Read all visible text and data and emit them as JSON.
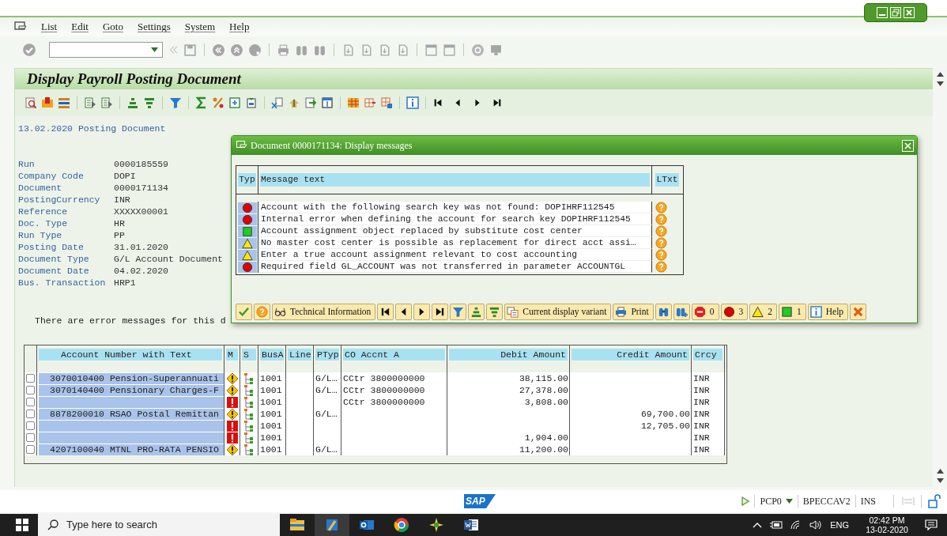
{
  "menu_bar": [
    "List",
    "Edit",
    "Goto",
    "Settings",
    "System",
    "Help"
  ],
  "title": "Display Payroll Posting Document",
  "list_title": "13.02.2020 Posting Document",
  "header_fields": [
    {
      "label": "Run",
      "value": "0000185559"
    },
    {
      "label": "Company Code",
      "value": "DOPI"
    },
    {
      "label": "Document",
      "value": "0000171134"
    },
    {
      "label": "PostingCurrency",
      "value": "INR"
    },
    {
      "label": "Reference",
      "value": "XXXXX00001"
    },
    {
      "label": "Doc. Type",
      "value": "HR"
    },
    {
      "label": "Run Type",
      "value": "PP"
    },
    {
      "label": "Posting Date",
      "value": "31.01.2020"
    },
    {
      "label": "Document Type",
      "value": "G/L Account Document"
    },
    {
      "label": "Document Date",
      "value": "04.02.2020"
    },
    {
      "label": "Bus. Transaction",
      "value": "HRP1"
    }
  ],
  "error_note": "There are error messages for this d",
  "table": {
    "columns": [
      "Account Number with Text",
      "M",
      "S",
      "BusA",
      "Line",
      "PTyp",
      "CO Accnt A",
      "Debit Amount",
      "Credit Amount",
      "Crcy"
    ],
    "rows": [
      {
        "selected": false,
        "account": "3070010400 Pension-Superannuati",
        "kind": "warning",
        "busa": "1001",
        "ptyp": "G/L…",
        "co_account": "CCtr 3800000000",
        "debit": "38,115.00",
        "crcy": "INR"
      },
      {
        "selected": false,
        "account": "3070140400 Pensionary Charges-F",
        "kind": "warning",
        "busa": "1001",
        "ptyp": "G/L…",
        "co_account": "CCtr 3800000000",
        "debit": "27,378.00",
        "crcy": "INR"
      },
      {
        "selected": false,
        "kind": "error",
        "busa": "1001",
        "co_account": "CCtr 3800000000",
        "debit": "3,808.00",
        "crcy": "INR"
      },
      {
        "selected": false,
        "account": "8878200010 RSAO Postal Remittan",
        "kind": "warning",
        "busa": "1001",
        "ptyp": "G/L…",
        "credit": "69,700.00",
        "crcy": "INR"
      },
      {
        "selected": false,
        "kind": "error",
        "busa": "1001",
        "credit": "12,705.00",
        "crcy": "INR"
      },
      {
        "selected": false,
        "kind": "error",
        "busa": "1001",
        "debit": "1,904.00",
        "crcy": "INR"
      },
      {
        "selected": false,
        "account": "4207100040 MTNL PRO-RATA PENSIO",
        "kind": "warning",
        "busa": "1001",
        "ptyp": "G/L…",
        "debit": "11,200.00",
        "crcy": "INR"
      }
    ]
  },
  "dialog": {
    "title": "Document 0000171134: Display messages",
    "columns": [
      "Typ",
      "Message text",
      "LTxt"
    ],
    "messages": [
      {
        "kind": "error",
        "text": "Account with the following search key was not found: DOPIHRF112545"
      },
      {
        "kind": "error",
        "text": "Internal error when defining the account for search key DOPIHRF112545"
      },
      {
        "kind": "success",
        "text": "Account assignment object replaced by substitute cost center"
      },
      {
        "kind": "warning",
        "text": "No master cost center is possible as replacement for direct acct assi…"
      },
      {
        "kind": "warning",
        "text": "Enter a true account assignment relevant to cost accounting"
      },
      {
        "kind": "error",
        "text": "Required field GL_ACCOUNT was not transferred in parameter ACCOUNTGL"
      }
    ],
    "toolbar": [
      {
        "kind": "confirm"
      },
      {
        "kind": "help"
      },
      {
        "kind": "technical",
        "label": "Technical Information"
      },
      {
        "kind": "first"
      },
      {
        "kind": "prev"
      },
      {
        "kind": "next"
      },
      {
        "kind": "last"
      },
      {
        "kind": "filter"
      },
      {
        "kind": "sort_asc"
      },
      {
        "kind": "sort_desc"
      },
      {
        "kind": "variant",
        "label": "Current display variant"
      },
      {
        "kind": "print",
        "label": "Print"
      },
      {
        "kind": "find"
      },
      {
        "kind": "find_next"
      },
      {
        "kind": "stop",
        "label": "0"
      },
      {
        "kind": "error",
        "label": "3"
      },
      {
        "kind": "warning",
        "label": "2"
      },
      {
        "kind": "success",
        "label": "1"
      },
      {
        "kind": "info",
        "label": "Help"
      },
      {
        "kind": "cancel"
      }
    ]
  },
  "status_bar": {
    "logo": "SAP",
    "system": "PCP0",
    "server": "BPECCAV2",
    "mode": "INS"
  },
  "taskbar": {
    "search_placeholder": "Type here to search",
    "language": "ENG",
    "time": "02:42 PM",
    "date": "13-02-2020"
  }
}
